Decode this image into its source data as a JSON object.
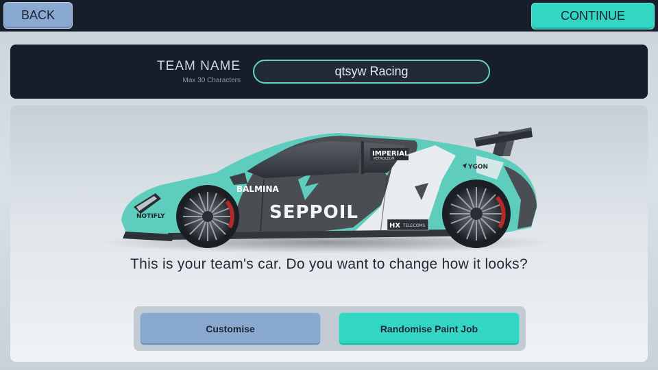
{
  "topbar": {
    "back_label": "BACK",
    "continue_label": "CONTINUE"
  },
  "team": {
    "label": "TEAM NAME",
    "sublabel": "Max 30 Characters",
    "name_value": "qtsyw Racing"
  },
  "car": {
    "livery_primary": "#5ecdbd",
    "livery_secondary": "#4a4d52",
    "livery_tertiary": "#e9ecef",
    "sponsors": {
      "main": "SEPPOIL",
      "side": "BALMINA",
      "front": "NOTIFLY",
      "door_top": "IMPERIAL",
      "door_top_sub": "PETROLEUM",
      "rear": "YGON",
      "rear_small": "HX",
      "rear_small_sub": "TELECOMS"
    }
  },
  "prompt": {
    "question": "This is your team's car. Do you want to change how it looks?"
  },
  "actions": {
    "customise_label": "Customise",
    "randomise_label": "Randomise Paint Job"
  },
  "colors": {
    "accent_teal": "#33d6c3",
    "accent_blue": "#8aa9d0",
    "panel_dark": "#171d2a"
  }
}
